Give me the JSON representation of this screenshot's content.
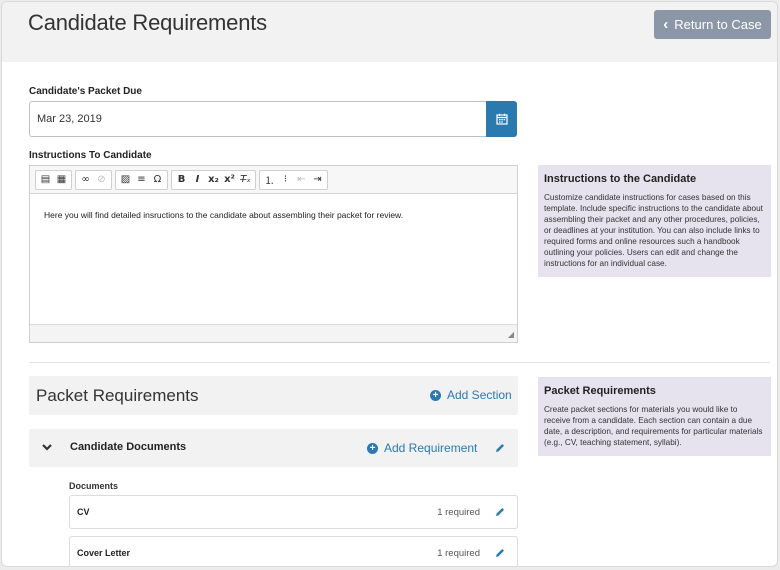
{
  "header": {
    "title": "Candidate Requirements",
    "return_button": "Return to Case"
  },
  "packet_due": {
    "label": "Candidate's Packet Due",
    "value": "Mar 23, 2019"
  },
  "instructions": {
    "label": "Instructions To Candidate",
    "body": "Here you will find detailed insructions to the candidate about assembling their packet for review.",
    "toolbar": [
      "paste-icon",
      "paste-text-icon",
      "link-icon",
      "unlink-icon",
      "image-icon",
      "horizontal-rule-icon",
      "special-char-icon",
      "bold-icon",
      "italic-icon",
      "subscript-icon",
      "superscript-icon",
      "remove-format-icon",
      "numbered-list-icon",
      "bulleted-list-icon",
      "outdent-icon",
      "indent-icon"
    ]
  },
  "help_instructions": {
    "title": "Instructions to the Candidate",
    "text": "Customize candidate instructions for cases based on this template. Include specific instructions to the candidate about assembling their packet and any other procedures, policies, or deadlines at your institution. You can also include links to required forms and online resources such a handbook outlining your policies. Users can edit and change the instructions for an individual case."
  },
  "packet": {
    "title": "Packet Requirements",
    "add_section": "Add Section",
    "sections": [
      {
        "title": "Candidate Documents",
        "add_requirement": "Add Requirement",
        "group_label": "Documents",
        "requirements": [
          {
            "name": "CV",
            "count": "1 required"
          },
          {
            "name": "Cover Letter",
            "count": "1 required"
          }
        ]
      }
    ]
  },
  "help_packet": {
    "title": "Packet Requirements",
    "text": "Create packet sections for materials you would like to receive from a candidate. Each section can contain a due date, a description, and requirements for particular materials (e.g., CV, teaching statement, syllabi)."
  },
  "colors": {
    "accent": "#2a7ab0",
    "return_button": "#8b97a6",
    "help_bg": "#e6e3ef",
    "header_bg": "#f2f2f2"
  }
}
